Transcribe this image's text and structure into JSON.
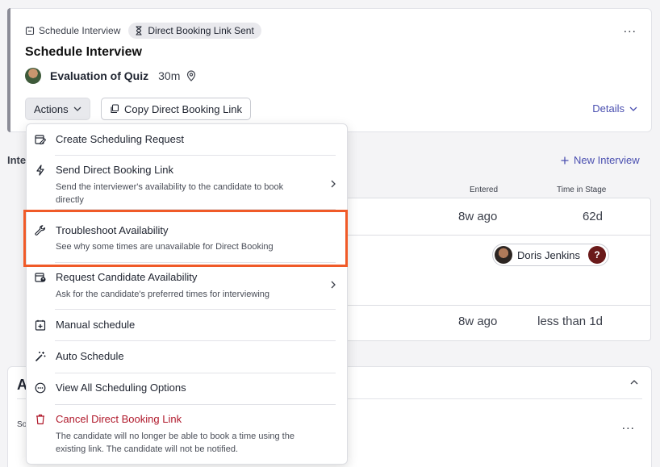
{
  "header": {
    "breadcrumb": "Schedule Interview",
    "status_badge": "Direct Booking Link Sent",
    "title": "Schedule Interview",
    "interview_name": "Evaluation of Quiz",
    "duration": "30m",
    "more_label": "...",
    "actions_label": "Actions",
    "copy_label": "Copy Direct Booking Link",
    "details_label": "Details"
  },
  "section": {
    "label": "Inte",
    "new_interview_label": "New Interview",
    "columns": [
      "Entered",
      "Time in Stage"
    ],
    "rows": [
      {
        "entered": "8w ago",
        "time_in_stage": "62d"
      },
      {
        "person": "Doris Jenkins",
        "status": "?"
      },
      {
        "entered": "8w ago",
        "time_in_stage": "less than 1d"
      }
    ]
  },
  "bottom": {
    "heading_fragment": "A",
    "subfragment": "So",
    "more_label": "..."
  },
  "menu": {
    "items": [
      {
        "label": "Create Scheduling Request",
        "description": "",
        "icon": "calendar-edit-icon"
      },
      {
        "label": "Send Direct Booking Link",
        "description": "Send the interviewer's availability to the candidate to book directly",
        "icon": "lightning-icon",
        "has_submenu": true
      },
      {
        "label": "Troubleshoot Availability",
        "description": "See why some times are unavailable for Direct Booking",
        "icon": "wrench-icon"
      },
      {
        "label": "Request Candidate Availability",
        "description": "Ask for the candidate's preferred times for interviewing",
        "icon": "calendar-person-icon",
        "has_submenu": true
      },
      {
        "label": "Manual schedule",
        "description": "",
        "icon": "calendar-plus-icon"
      },
      {
        "label": "Auto Schedule",
        "description": "",
        "icon": "magic-wand-icon"
      },
      {
        "label": "View All Scheduling Options",
        "description": "",
        "icon": "more-circle-icon"
      },
      {
        "label": "Cancel Direct Booking Link",
        "description": "The candidate will no longer be able to book a time using the existing link. The candidate will not be notified.",
        "icon": "trash-icon",
        "danger": true
      }
    ]
  },
  "colors": {
    "accent": "#4a4fb0",
    "danger": "#b0192b",
    "highlight": "#f05a28"
  }
}
